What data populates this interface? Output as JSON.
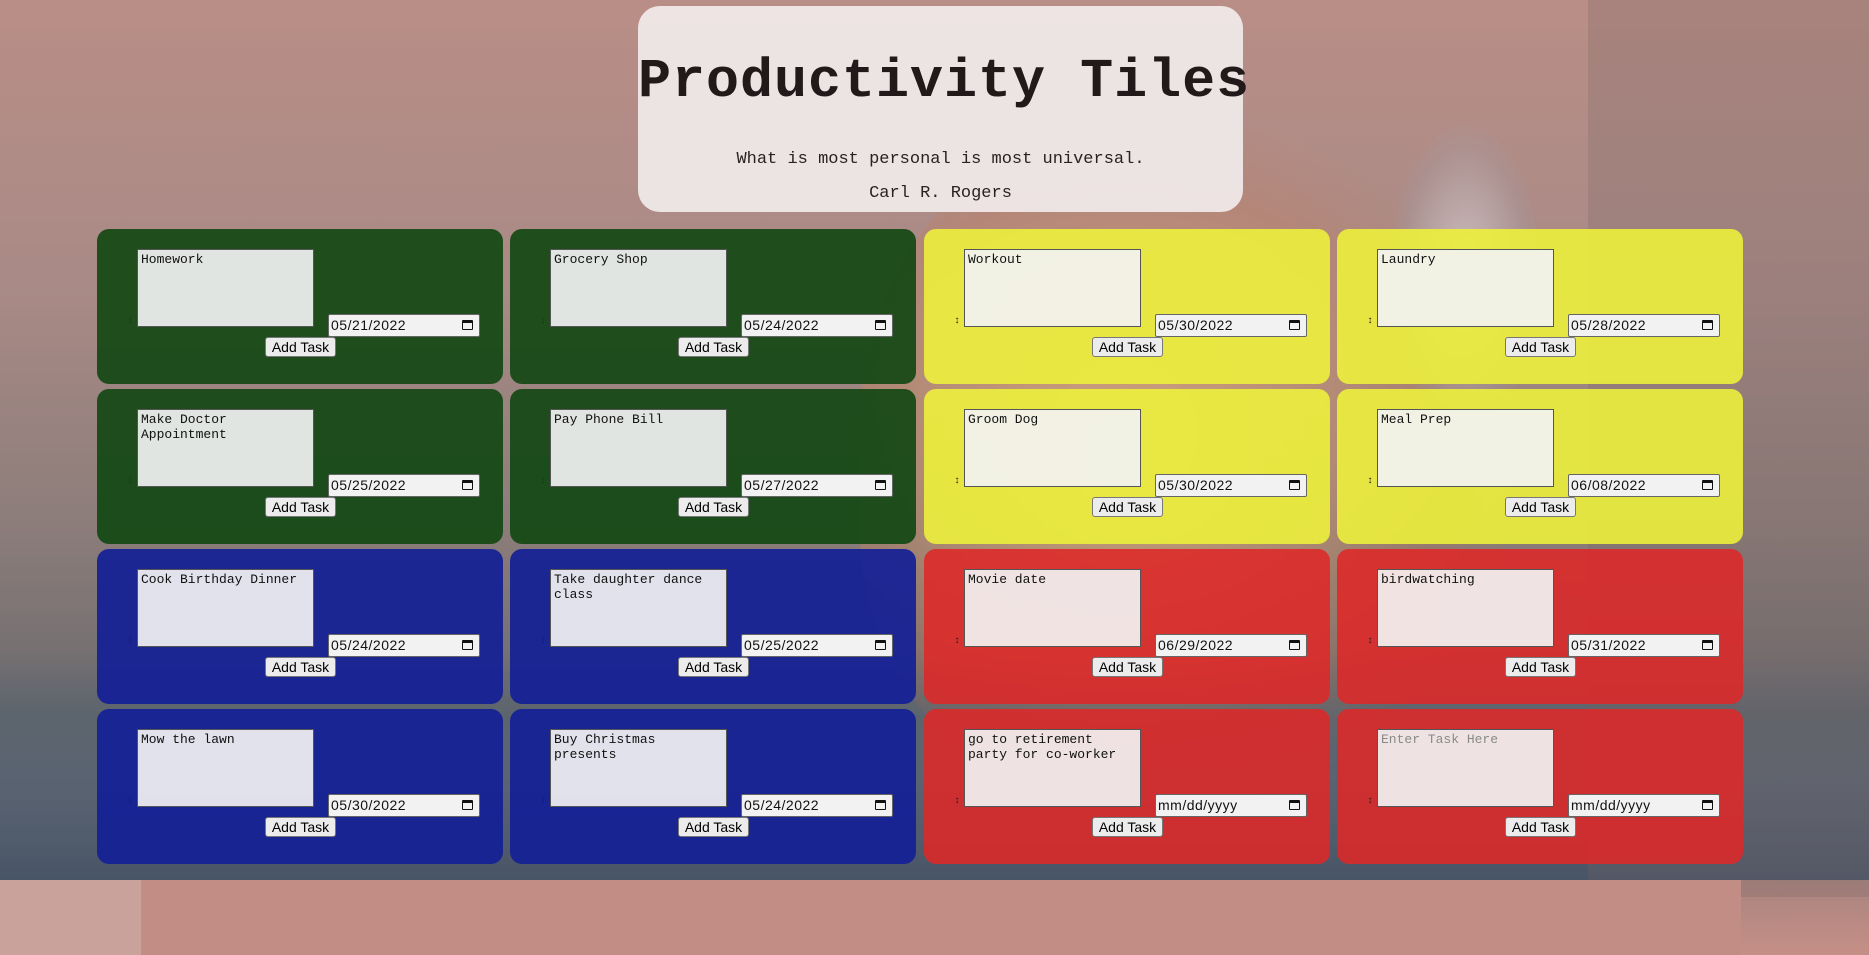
{
  "header": {
    "title": "Productivity Tiles",
    "quote": "What is most personal is most universal.",
    "author": "Carl R. Rogers"
  },
  "colors": {
    "green": "#144814",
    "yellow": "#ecf03c",
    "blue": "#142096",
    "red": "#de2828"
  },
  "add_label": "Add Task",
  "placeholder": "Enter Task Here",
  "tiles": [
    {
      "task": "Homework",
      "date": "05/21/2022",
      "color": "green"
    },
    {
      "task": "Grocery Shop",
      "date": "05/24/2022",
      "color": "green"
    },
    {
      "task": "Workout",
      "date": "05/30/2022",
      "color": "yellow"
    },
    {
      "task": "Laundry",
      "date": "05/28/2022",
      "color": "yellow"
    },
    {
      "task": "Make Doctor Appointment",
      "date": "05/25/2022",
      "color": "green"
    },
    {
      "task": "Pay Phone Bill",
      "date": "05/27/2022",
      "color": "green"
    },
    {
      "task": "Groom Dog",
      "date": "05/30/2022",
      "color": "yellow"
    },
    {
      "task": "Meal Prep",
      "date": "06/08/2022",
      "color": "yellow"
    },
    {
      "task": "Cook Birthday Dinner",
      "date": "05/24/2022",
      "color": "blue"
    },
    {
      "task": "Take daughter dance class",
      "date": "05/25/2022",
      "color": "blue"
    },
    {
      "task": "Movie date",
      "date": "06/29/2022",
      "color": "red"
    },
    {
      "task": "birdwatching",
      "date": "05/31/2022",
      "color": "red"
    },
    {
      "task": "Mow the lawn",
      "date": "05/30/2022",
      "color": "blue"
    },
    {
      "task": "Buy Christmas presents",
      "date": "05/24/2022",
      "color": "blue"
    },
    {
      "task": "go to retirement party for co-worker",
      "date": "mm/dd/yyyy",
      "color": "red"
    },
    {
      "task": "",
      "date": "mm/dd/yyyy",
      "color": "red"
    }
  ]
}
